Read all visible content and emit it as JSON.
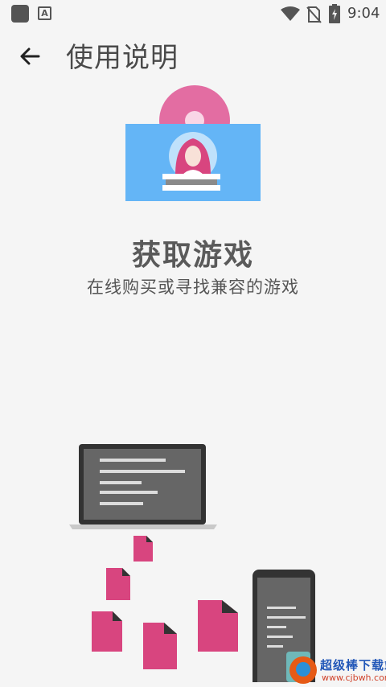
{
  "status_bar": {
    "time": "9:04",
    "notification_icon": "a-icon",
    "wifi_icon": "wifi-icon",
    "sim_icon": "no-sim-icon",
    "battery_icon": "battery-charging-icon"
  },
  "header": {
    "back_icon": "arrow-left-icon",
    "title": "使用说明"
  },
  "slide": {
    "heading": "获取游戏",
    "description": "在线购买或寻找兼容的游戏"
  },
  "watermark": {
    "brand": "超级棒下载站",
    "site": "www.cjbwh.com"
  },
  "colors": {
    "background": "#f5f5f5",
    "pink": "#d8457f",
    "blue": "#64b5f6",
    "dark_gray": "#666666"
  }
}
